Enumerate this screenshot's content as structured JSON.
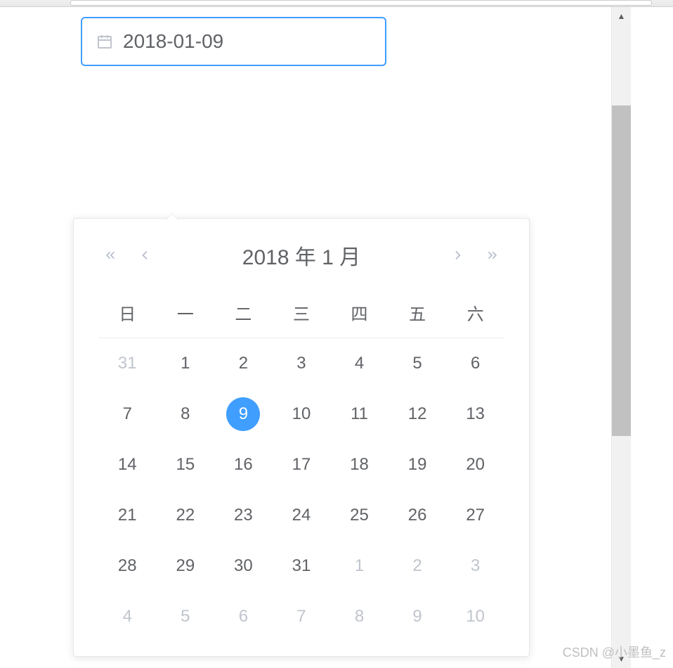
{
  "input": {
    "value": "2018-01-09"
  },
  "panel": {
    "header_label": "2018 年  1 月"
  },
  "weekdays": [
    "日",
    "一",
    "二",
    "三",
    "四",
    "五",
    "六"
  ],
  "weeks": [
    [
      {
        "d": "31",
        "type": "other"
      },
      {
        "d": "1",
        "type": "normal"
      },
      {
        "d": "2",
        "type": "normal"
      },
      {
        "d": "3",
        "type": "normal"
      },
      {
        "d": "4",
        "type": "normal"
      },
      {
        "d": "5",
        "type": "normal"
      },
      {
        "d": "6",
        "type": "normal"
      }
    ],
    [
      {
        "d": "7",
        "type": "normal"
      },
      {
        "d": "8",
        "type": "normal"
      },
      {
        "d": "9",
        "type": "selected"
      },
      {
        "d": "10",
        "type": "normal"
      },
      {
        "d": "11",
        "type": "normal"
      },
      {
        "d": "12",
        "type": "normal"
      },
      {
        "d": "13",
        "type": "normal"
      }
    ],
    [
      {
        "d": "14",
        "type": "normal"
      },
      {
        "d": "15",
        "type": "normal"
      },
      {
        "d": "16",
        "type": "normal"
      },
      {
        "d": "17",
        "type": "normal"
      },
      {
        "d": "18",
        "type": "normal"
      },
      {
        "d": "19",
        "type": "normal"
      },
      {
        "d": "20",
        "type": "normal"
      }
    ],
    [
      {
        "d": "21",
        "type": "normal"
      },
      {
        "d": "22",
        "type": "normal"
      },
      {
        "d": "23",
        "type": "normal"
      },
      {
        "d": "24",
        "type": "normal"
      },
      {
        "d": "25",
        "type": "normal"
      },
      {
        "d": "26",
        "type": "normal"
      },
      {
        "d": "27",
        "type": "normal"
      }
    ],
    [
      {
        "d": "28",
        "type": "normal"
      },
      {
        "d": "29",
        "type": "normal"
      },
      {
        "d": "30",
        "type": "normal"
      },
      {
        "d": "31",
        "type": "normal"
      },
      {
        "d": "1",
        "type": "other"
      },
      {
        "d": "2",
        "type": "other"
      },
      {
        "d": "3",
        "type": "other"
      }
    ],
    [
      {
        "d": "4",
        "type": "other"
      },
      {
        "d": "5",
        "type": "other"
      },
      {
        "d": "6",
        "type": "other"
      },
      {
        "d": "7",
        "type": "other"
      },
      {
        "d": "8",
        "type": "other"
      },
      {
        "d": "9",
        "type": "other"
      },
      {
        "d": "10",
        "type": "other"
      }
    ]
  ],
  "watermark": "CSDN @小墨鱼_z"
}
